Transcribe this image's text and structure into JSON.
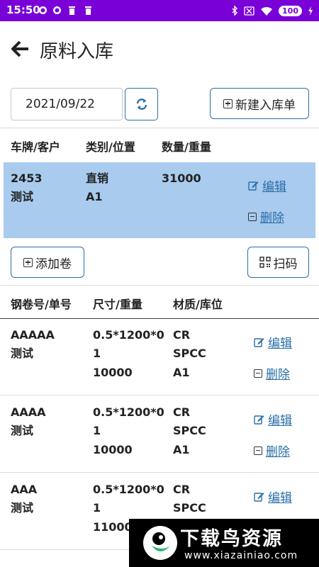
{
  "status": {
    "time": "15:50",
    "battery": "100"
  },
  "header": {
    "title": "原料入库"
  },
  "toolbar": {
    "date": "2021/09/22",
    "new_order_label": "新建入库单"
  },
  "order_table": {
    "headers": [
      "车牌/客户",
      "类别/位置",
      "数量/重量"
    ],
    "rows": [
      {
        "plate": "2453",
        "customer": "测试",
        "category": "直销",
        "position": "A1",
        "quantity": "31000",
        "edit": "编辑",
        "delete": "删除"
      }
    ]
  },
  "coil_actions": {
    "add_label": "添加卷",
    "scan_label": "扫码"
  },
  "coil_table": {
    "headers": [
      "钢卷号/单号",
      "尺寸/重量",
      "材质/库位"
    ],
    "rows": [
      {
        "coil": "AAAAA",
        "order": "测试",
        "size1": "0.5*1200*0",
        "size2": "1",
        "weight": "10000",
        "material": "CR",
        "grade": "SPCC",
        "location": "A1",
        "edit": "编辑",
        "delete": "删除"
      },
      {
        "coil": "AAAA",
        "order": "测试",
        "size1": "0.5*1200*0",
        "size2": "1",
        "weight": "10000",
        "material": "CR",
        "grade": "SPCC",
        "location": "A1",
        "edit": "编辑",
        "delete": "删除"
      },
      {
        "coil": "AAA",
        "order": "测试",
        "size1": "0.5*1200*0",
        "size2": "1",
        "weight": "11000",
        "material": "CR",
        "grade": "SPCC",
        "location": "",
        "edit": "编辑",
        "delete": ""
      }
    ]
  },
  "watermark": {
    "brand": "下载鸟资源",
    "url": "www.xiazainiao.com"
  }
}
